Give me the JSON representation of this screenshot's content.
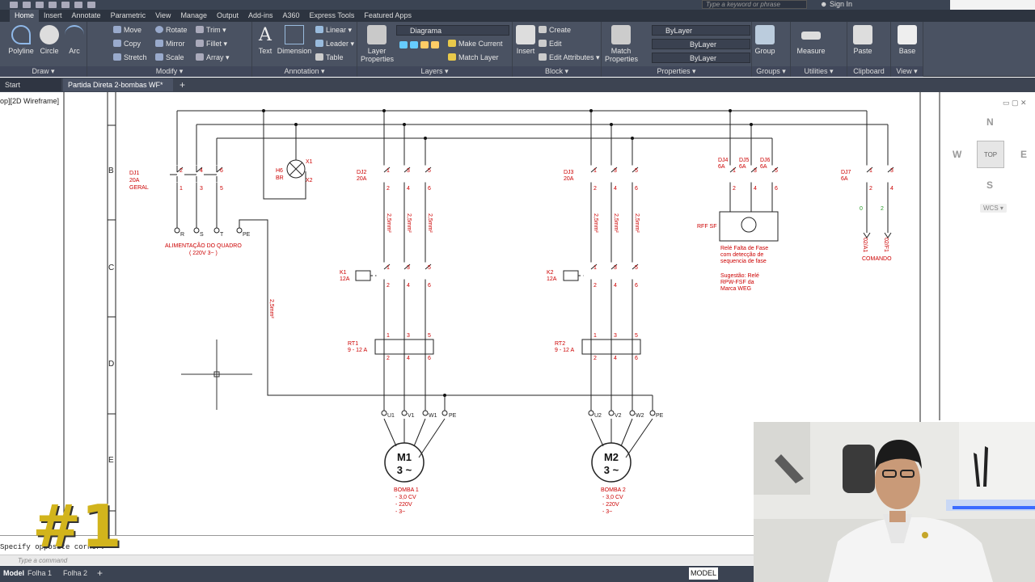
{
  "title_bar": {
    "search_placeholder": "Type a keyword or phrase",
    "sign_in": "Sign In"
  },
  "ribbon_tabs": [
    "Home",
    "Insert",
    "Annotate",
    "Parametric",
    "View",
    "Manage",
    "Output",
    "Add-ins",
    "A360",
    "Express Tools",
    "Featured Apps"
  ],
  "ribbon": {
    "draw": {
      "title": "Draw ▾",
      "polyline": "Polyline",
      "circle": "Circle",
      "arc": "Arc"
    },
    "modify": {
      "title": "Modify ▾",
      "move": "Move",
      "rotate": "Rotate",
      "trim": "Trim ▾",
      "copy": "Copy",
      "mirror": "Mirror",
      "fillet": "Fillet ▾",
      "stretch": "Stretch",
      "scale": "Scale",
      "array": "Array ▾"
    },
    "annotation": {
      "title": "Annotation ▾",
      "text": "Text",
      "dimension": "Dimension",
      "linear": "Linear ▾",
      "leader": "Leader ▾",
      "table": "Table"
    },
    "layers": {
      "title": "Layers ▾",
      "layer_properties": "Layer Properties",
      "current_layer": "Diagrama",
      "make_current": "Make Current",
      "match_layer": "Match Layer"
    },
    "block": {
      "title": "Block ▾",
      "insert": "Insert",
      "create": "Create",
      "edit": "Edit",
      "edit_attributes": "Edit Attributes ▾"
    },
    "properties": {
      "title": "Properties ▾",
      "match_properties": "Match Properties",
      "color": "ByLayer",
      "linetype": "ByLayer",
      "lineweight": "ByLayer"
    },
    "groups": {
      "title": "Groups ▾",
      "group": "Group"
    },
    "utilities": {
      "title": "Utilities ▾",
      "measure": "Measure"
    },
    "clipboard": {
      "title": "Clipboard",
      "paste": "Paste"
    },
    "view": {
      "title": "View ▾",
      "base": "Base"
    }
  },
  "file_tabs": [
    "Start",
    "Partida Direta 2-bombas WF*"
  ],
  "viewport_label": "op][2D Wireframe]",
  "navcube": {
    "n": "N",
    "s": "S",
    "e": "E",
    "w": "W",
    "top": "TOP",
    "wcs": "WCS ▾"
  },
  "drawing": {
    "row_labels": [
      "B",
      "C",
      "D",
      "E"
    ],
    "dj1": [
      "DJ1",
      "20A",
      "GERAL"
    ],
    "dj1_terminals": [
      "2",
      "4",
      "6",
      "1",
      "3",
      "5"
    ],
    "supply": [
      "R",
      "S",
      "T",
      "PE"
    ],
    "supply_caption": [
      "ALIMENTAÇÃO DO QUADRO",
      "( 220V   3~ )"
    ],
    "lamp": [
      "H6",
      "BR",
      "X1",
      "X2"
    ],
    "pe_wire": "2,5mm²",
    "dj2": [
      "DJ2",
      "20A"
    ],
    "dj3": [
      "DJ3",
      "20A"
    ],
    "breaker_terms_top": [
      "1",
      "3",
      "5"
    ],
    "breaker_terms_bot": [
      "2",
      "4",
      "6"
    ],
    "wire_gauge": "2,5mm²",
    "k1": [
      "K1",
      "12A"
    ],
    "k2": [
      "K2",
      "12A"
    ],
    "rt1": [
      "RT1",
      "9 - 12 A"
    ],
    "rt2": [
      "RT2",
      "9 - 12 A"
    ],
    "m1_terms": [
      "U1",
      "V1",
      "W1",
      "PE"
    ],
    "m2_terms": [
      "U2",
      "V2",
      "W2",
      "PE"
    ],
    "m1": [
      "M1",
      "3 ~"
    ],
    "m2": [
      "M2",
      "3 ~"
    ],
    "bomba1": [
      "BOMBA  1",
      "- 3,0 CV",
      "- 220V",
      "- 3~"
    ],
    "bomba2": [
      "BOMBA  2",
      "- 3,0 CV",
      "- 220V",
      "- 3~"
    ],
    "dj456": [
      "DJ4",
      "6A",
      "DJ5",
      "6A",
      "DJ6",
      "6A"
    ],
    "rff": "RFF SF",
    "rff_caption": [
      "Relé Falta de Fase",
      "com detecção de",
      "sequencia de fase"
    ],
    "sugestao": [
      "Sugestão: Relé",
      "RPW-FSF da",
      "Marca WEG"
    ],
    "dj7": [
      "DJ7",
      "6A"
    ],
    "dj7_terms": [
      "1",
      "3",
      "2",
      "4"
    ],
    "comando_wires": [
      "0",
      "2"
    ],
    "comando_labels": [
      "02/A1",
      "02/F1"
    ],
    "comando": "COMANDO"
  },
  "command": {
    "history": "Specify opposite corner:",
    "placeholder": "Type a command"
  },
  "layout_tabs": [
    "Model",
    "Folha 1",
    "Folha 2"
  ],
  "status": {
    "model": "MODEL"
  },
  "overlay_badge": "#1",
  "colors": {
    "ribbon": "#4a5262",
    "drawing_red": "#cc0000",
    "drawing_green": "#2a9d2a",
    "badge": "#d2b41c"
  }
}
